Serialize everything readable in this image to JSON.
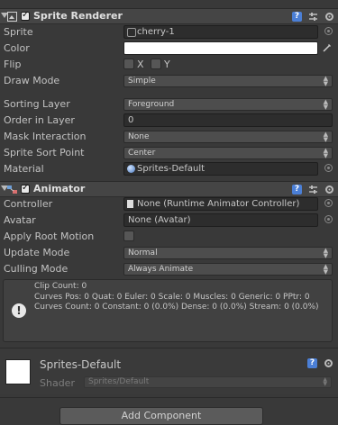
{
  "sprite_renderer": {
    "title": "Sprite Renderer",
    "sprite_label": "Sprite",
    "sprite_value": "cherry-1",
    "color_label": "Color",
    "color_value": "#ffffff",
    "flip_label": "Flip",
    "flip_x": "X",
    "flip_y": "Y",
    "draw_mode_label": "Draw Mode",
    "draw_mode_value": "Simple",
    "sorting_layer_label": "Sorting Layer",
    "sorting_layer_value": "Foreground",
    "order_label": "Order in Layer",
    "order_value": "0",
    "mask_label": "Mask Interaction",
    "mask_value": "None",
    "sort_point_label": "Sprite Sort Point",
    "sort_point_value": "Center",
    "material_label": "Material",
    "material_value": "Sprites-Default"
  },
  "animator": {
    "title": "Animator",
    "controller_label": "Controller",
    "controller_value": "None (Runtime Animator Controller)",
    "avatar_label": "Avatar",
    "avatar_value": "None (Avatar)",
    "root_motion_label": "Apply Root Motion",
    "update_mode_label": "Update Mode",
    "update_mode_value": "Normal",
    "culling_label": "Culling Mode",
    "culling_value": "Always Animate",
    "info_lines": [
      "Clip Count: 0",
      "Curves Pos: 0 Quat: 0 Euler: 0 Scale: 0 Muscles: 0 Generic: 0 PPtr: 0",
      "Curves Count: 0 Constant: 0 (0.0%) Dense: 0 (0.0%) Stream: 0 (0.0%)"
    ]
  },
  "material": {
    "name": "Sprites-Default",
    "shader_label": "Shader",
    "shader_value": "Sprites/Default"
  },
  "add_component_label": "Add Component",
  "colors": {
    "panel": "#393939",
    "help_icon": "#4b7fd6"
  }
}
